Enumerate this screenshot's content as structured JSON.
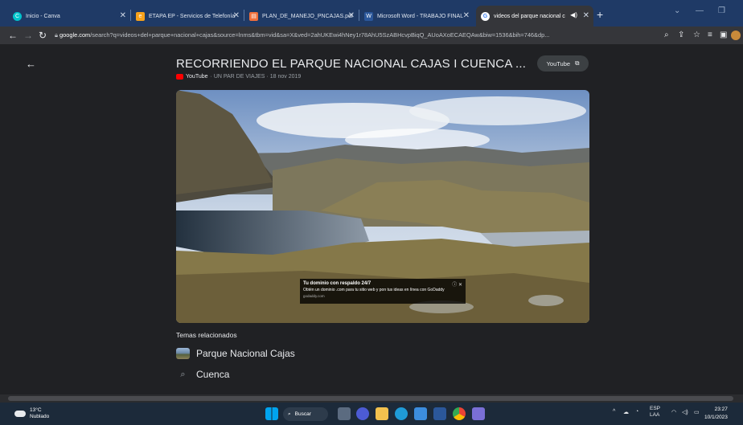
{
  "browser": {
    "tabs": [
      {
        "title": "Inicio - Canva",
        "favicon": "canva-icon",
        "color": "#00c4cc"
      },
      {
        "title": "ETAPA EP - Servicios de Telefonía",
        "favicon": "etapa-icon",
        "color": "#f7a21b"
      },
      {
        "title": "PLAN_DE_MANEJO_PNCAJAS.pdf",
        "favicon": "pdf-icon",
        "color": "#f2703b"
      },
      {
        "title": "Microsoft Word - TRABAJO FINAL",
        "favicon": "word-icon",
        "color": "#2b579a"
      },
      {
        "title": "videos del parque nacional c",
        "favicon": "google-icon",
        "color": "#ffffff"
      }
    ],
    "url_host": "google.com",
    "url_rest": "/search?q=videos+del+parque+nacional+cajas&source=lnms&tbm=vid&sa=X&ved=2ahUKEwi4hNey1r78AhU5SzABHcvpBiqQ_AUoAXoECAEQAw&biw=1536&bih=746&dp..."
  },
  "video": {
    "title": "RECORRIENDO EL PARQUE NACIONAL CAJAS I CUENCA ...",
    "source": "YouTube",
    "channel": "UN PAR DE VIAJES",
    "date": "18 nov 2019",
    "separator": "·",
    "youtube_button": "YouTube",
    "ad": {
      "headline": "Tu dominio con respaldo 24/7",
      "description": "Obtén un dominio .com para tu sitio web y pon tus ideas en línea con GoDaddy",
      "url": "godaddy.com"
    }
  },
  "related": {
    "heading": "Temas relacionados",
    "items": [
      {
        "label": "Parque Nacional Cajas",
        "kind": "image"
      },
      {
        "label": "Cuenca",
        "kind": "search"
      }
    ]
  },
  "taskbar": {
    "weather_temp": "13°C",
    "weather_desc": "Nublado",
    "search_label": "Buscar",
    "lang_top": "ESP",
    "lang_bottom": "LAA",
    "time": "23:27",
    "date": "10/1/2023"
  }
}
